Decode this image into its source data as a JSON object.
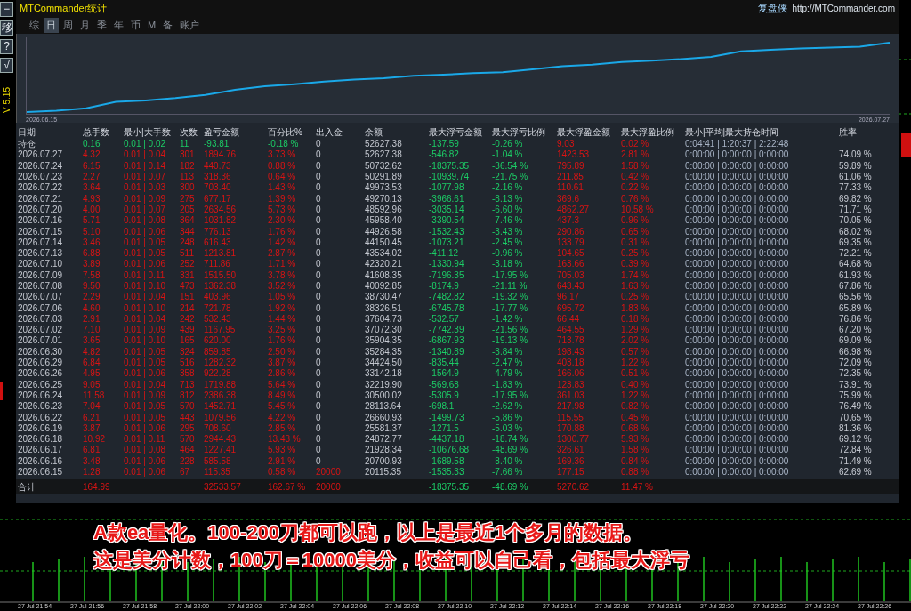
{
  "window": {
    "title": "MTCommander统计",
    "brand": "复盘侠",
    "url": "http://MTCommander.com"
  },
  "side_toolbar": {
    "buttons": [
      "−",
      "移",
      "?",
      "√"
    ],
    "version": "V 5.15"
  },
  "tabs": [
    {
      "label": "综",
      "selected": false
    },
    {
      "label": "日",
      "selected": true
    },
    {
      "label": "周",
      "selected": false
    },
    {
      "label": "月",
      "selected": false
    },
    {
      "label": "季",
      "selected": false
    },
    {
      "label": "年",
      "selected": false
    },
    {
      "label": "币",
      "selected": false
    },
    {
      "label": "M",
      "selected": false
    },
    {
      "label": "备",
      "selected": false
    },
    {
      "label": "账户",
      "selected": false
    }
  ],
  "equity_chart": {
    "start_label": "2026.06.15",
    "end_label": "2026.07.27"
  },
  "table": {
    "columns": [
      "日期",
      "总手数",
      "最小|大手数",
      "次数",
      "盈亏金额",
      "百分比%",
      "出入金",
      "余额",
      "最大浮亏金额",
      "最大浮亏比例",
      "最大浮盈金额",
      "最大浮盈比例",
      "最小|平均|最大持仓时间",
      "胜率"
    ],
    "rows": [
      {
        "kind": "open",
        "cells": [
          "持仓",
          "0.16",
          "0.01 | 0.02",
          "11",
          "-93.81",
          "-0.18 %",
          "0",
          "52627.38",
          "-137.59",
          "-0.26 %",
          "9.03",
          "0.02 %",
          "0:04:41 | 1:20:37 | 2:22:48",
          null
        ]
      },
      {
        "kind": "day",
        "cells": [
          "2026.07.27",
          "4.32",
          "0.01 | 0.04",
          "301",
          "1894.76",
          "3.73 %",
          "0",
          "52627.38",
          "-546.82",
          "-1.04 %",
          "1423.53",
          "2.81 %",
          "0:00:00 | 0:00:00 | 0:00:00",
          "74.09 %"
        ]
      },
      {
        "kind": "day",
        "cells": [
          "2026.07.24",
          "6.15",
          "0.01 | 0.14",
          "182",
          "440.73",
          "0.88 %",
          "0",
          "50732.62",
          "-18375.35",
          "-36.54 %",
          "795.89",
          "1.58 %",
          "0:00:00 | 0:00:00 | 0:00:00",
          "59.89 %"
        ]
      },
      {
        "kind": "day",
        "cells": [
          "2026.07.23",
          "2.27",
          "0.01 | 0.07",
          "113",
          "318.36",
          "0.64 %",
          "0",
          "50291.89",
          "-10939.74",
          "-21.75 %",
          "211.85",
          "0.42 %",
          "0:00:00 | 0:00:00 | 0:00:00",
          "61.06 %"
        ]
      },
      {
        "kind": "day",
        "cells": [
          "2026.07.22",
          "3.64",
          "0.01 | 0.03",
          "300",
          "703.40",
          "1.43 %",
          "0",
          "49973.53",
          "-1077.98",
          "-2.16 %",
          "110.61",
          "0.22 %",
          "0:00:00 | 0:00:00 | 0:00:00",
          "77.33 %"
        ]
      },
      {
        "kind": "day",
        "cells": [
          "2026.07.21",
          "4.93",
          "0.01 | 0.09",
          "275",
          "677.17",
          "1.39 %",
          "0",
          "49270.13",
          "-3966.61",
          "-8.13 %",
          "369.6",
          "0.76 %",
          "0:00:00 | 0:00:00 | 0:00:00",
          "69.82 %"
        ]
      },
      {
        "kind": "day",
        "cells": [
          "2026.07.20",
          "4.00",
          "0.01 | 0.07",
          "205",
          "2634.56",
          "5.73 %",
          "0",
          "48592.96",
          "-3035.14",
          "-6.60 %",
          "4862.27",
          "10.58 %",
          "0:00:00 | 0:00:00 | 0:00:00",
          "71.71 %"
        ]
      },
      {
        "kind": "day",
        "cells": [
          "2026.07.16",
          "5.71",
          "0.01 | 0.08",
          "364",
          "1031.82",
          "2.30 %",
          "0",
          "45958.40",
          "-3390.54",
          "-7.46 %",
          "437.3",
          "0.96 %",
          "0:00:00 | 0:00:00 | 0:00:00",
          "70.05 %"
        ]
      },
      {
        "kind": "day",
        "cells": [
          "2026.07.15",
          "5.10",
          "0.01 | 0.06",
          "344",
          "776.13",
          "1.76 %",
          "0",
          "44926.58",
          "-1532.43",
          "-3.43 %",
          "290.86",
          "0.65 %",
          "0:00:00 | 0:00:00 | 0:00:00",
          "68.02 %"
        ]
      },
      {
        "kind": "day",
        "cells": [
          "2026.07.14",
          "3.46",
          "0.01 | 0.05",
          "248",
          "616.43",
          "1.42 %",
          "0",
          "44150.45",
          "-1073.21",
          "-2.45 %",
          "133.79",
          "0.31 %",
          "0:00:00 | 0:00:00 | 0:00:00",
          "69.35 %"
        ]
      },
      {
        "kind": "day",
        "cells": [
          "2026.07.13",
          "6.88",
          "0.01 | 0.05",
          "511",
          "1213.81",
          "2.87 %",
          "0",
          "43534.02",
          "-411.12",
          "-0.96 %",
          "104.65",
          "0.25 %",
          "0:00:00 | 0:00:00 | 0:00:00",
          "72.21 %"
        ]
      },
      {
        "kind": "day",
        "cells": [
          "2026.07.10",
          "3.89",
          "0.01 | 0.06",
          "252",
          "711.86",
          "1.71 %",
          "0",
          "42320.21",
          "-1330.94",
          "-3.18 %",
          "163.66",
          "0.39 %",
          "0:00:00 | 0:00:00 | 0:00:00",
          "64.68 %"
        ]
      },
      {
        "kind": "day",
        "cells": [
          "2026.07.09",
          "7.58",
          "0.01 | 0.11",
          "331",
          "1515.50",
          "3.78 %",
          "0",
          "41608.35",
          "-7196.35",
          "-17.95 %",
          "705.03",
          "1.74 %",
          "0:00:00 | 0:00:00 | 0:00:00",
          "61.93 %"
        ]
      },
      {
        "kind": "day",
        "cells": [
          "2026.07.08",
          "9.50",
          "0.01 | 0.10",
          "473",
          "1362.38",
          "3.52 %",
          "0",
          "40092.85",
          "-8174.9",
          "-21.11 %",
          "643.43",
          "1.63 %",
          "0:00:00 | 0:00:00 | 0:00:00",
          "67.86 %"
        ]
      },
      {
        "kind": "day",
        "cells": [
          "2026.07.07",
          "2.29",
          "0.01 | 0.04",
          "151",
          "403.96",
          "1.05 %",
          "0",
          "38730.47",
          "-7482.82",
          "-19.32 %",
          "96.17",
          "0.25 %",
          "0:00:00 | 0:00:00 | 0:00:00",
          "65.56 %"
        ]
      },
      {
        "kind": "day",
        "cells": [
          "2026.07.06",
          "4.60",
          "0.01 | 0.10",
          "214",
          "721.78",
          "1.92 %",
          "0",
          "38326.51",
          "-6745.78",
          "-17.77 %",
          "695.72",
          "1.83 %",
          "0:00:00 | 0:00:00 | 0:00:00",
          "65.89 %"
        ]
      },
      {
        "kind": "day",
        "cells": [
          "2026.07.03",
          "2.91",
          "0.01 | 0.04",
          "242",
          "532.43",
          "1.44 %",
          "0",
          "37604.73",
          "-532.57",
          "-1.42 %",
          "66.44",
          "0.18 %",
          "0:00:00 | 0:00:00 | 0:00:00",
          "76.86 %"
        ]
      },
      {
        "kind": "day",
        "cells": [
          "2026.07.02",
          "7.10",
          "0.01 | 0.09",
          "439",
          "1167.95",
          "3.25 %",
          "0",
          "37072.30",
          "-7742.39",
          "-21.56 %",
          "464.55",
          "1.29 %",
          "0:00:00 | 0:00:00 | 0:00:00",
          "67.20 %"
        ]
      },
      {
        "kind": "day",
        "cells": [
          "2026.07.01",
          "3.65",
          "0.01 | 0.10",
          "165",
          "620.00",
          "1.76 %",
          "0",
          "35904.35",
          "-6867.93",
          "-19.13 %",
          "713.78",
          "2.02 %",
          "0:00:00 | 0:00:00 | 0:00:00",
          "69.09 %"
        ]
      },
      {
        "kind": "day",
        "cells": [
          "2026.06.30",
          "4.82",
          "0.01 | 0.05",
          "324",
          "859.85",
          "2.50 %",
          "0",
          "35284.35",
          "-1340.89",
          "-3.84 %",
          "198.43",
          "0.57 %",
          "0:00:00 | 0:00:00 | 0:00:00",
          "66.98 %"
        ]
      },
      {
        "kind": "day",
        "cells": [
          "2026.06.29",
          "6.84",
          "0.01 | 0.05",
          "516",
          "1282.32",
          "3.87 %",
          "0",
          "34424.50",
          "-835.44",
          "-2.47 %",
          "403.18",
          "1.22 %",
          "0:00:00 | 0:00:00 | 0:00:00",
          "72.09 %"
        ]
      },
      {
        "kind": "day",
        "cells": [
          "2026.06.26",
          "4.95",
          "0.01 | 0.06",
          "358",
          "922.28",
          "2.86 %",
          "0",
          "33142.18",
          "-1564.9",
          "-4.79 %",
          "166.06",
          "0.51 %",
          "0:00:00 | 0:00:00 | 0:00:00",
          "72.35 %"
        ]
      },
      {
        "kind": "day",
        "cells": [
          "2026.06.25",
          "9.05",
          "0.01 | 0.04",
          "713",
          "1719.88",
          "5.64 %",
          "0",
          "32219.90",
          "-569.68",
          "-1.83 %",
          "123.83",
          "0.40 %",
          "0:00:00 | 0:00:00 | 0:00:00",
          "73.91 %"
        ]
      },
      {
        "kind": "day",
        "cells": [
          "2026.06.24",
          "11.58",
          "0.01 | 0.09",
          "812",
          "2386.38",
          "8.49 %",
          "0",
          "30500.02",
          "-5305.9",
          "-17.95 %",
          "361.03",
          "1.22 %",
          "0:00:00 | 0:00:00 | 0:00:00",
          "75.99 %"
        ]
      },
      {
        "kind": "day",
        "cells": [
          "2026.06.23",
          "7.04",
          "0.01 | 0.05",
          "570",
          "1452.71",
          "5.45 %",
          "0",
          "28113.64",
          "-698.1",
          "-2.62 %",
          "217.98",
          "0.82 %",
          "0:00:00 | 0:00:00 | 0:00:00",
          "76.49 %"
        ]
      },
      {
        "kind": "day",
        "cells": [
          "2026.06.22",
          "6.21",
          "0.01 | 0.05",
          "443",
          "1079.56",
          "4.22 %",
          "0",
          "26660.93",
          "-1499.73",
          "-5.86 %",
          "115.55",
          "0.45 %",
          "0:00:00 | 0:00:00 | 0:00:00",
          "70.65 %"
        ]
      },
      {
        "kind": "day",
        "cells": [
          "2026.06.19",
          "3.87",
          "0.01 | 0.06",
          "295",
          "708.60",
          "2.85 %",
          "0",
          "25581.37",
          "-1271.5",
          "-5.03 %",
          "170.88",
          "0.68 %",
          "0:00:00 | 0:00:00 | 0:00:00",
          "81.36 %"
        ]
      },
      {
        "kind": "day",
        "cells": [
          "2026.06.18",
          "10.92",
          "0.01 | 0.11",
          "570",
          "2944.43",
          "13.43 %",
          "0",
          "24872.77",
          "-4437.18",
          "-18.74 %",
          "1300.77",
          "5.93 %",
          "0:00:00 | 0:00:00 | 0:00:00",
          "69.12 %"
        ]
      },
      {
        "kind": "day",
        "cells": [
          "2026.06.17",
          "6.81",
          "0.01 | 0.08",
          "464",
          "1227.41",
          "5.93 %",
          "0",
          "21928.34",
          "-10676.68",
          "-48.69 %",
          "326.61",
          "1.58 %",
          "0:00:00 | 0:00:00 | 0:00:00",
          "72.84 %"
        ]
      },
      {
        "kind": "day",
        "cells": [
          "2026.06.16",
          "3.48",
          "0.01 | 0.06",
          "228",
          "585.58",
          "2.91 %",
          "0",
          "20700.93",
          "-1689.58",
          "-8.40 %",
          "169.36",
          "0.84 %",
          "0:00:00 | 0:00:00 | 0:00:00",
          "71.49 %"
        ]
      },
      {
        "kind": "day",
        "cells": [
          "2026.06.15",
          "1.28",
          "0.01 | 0.06",
          "67",
          "115.35",
          "0.58 %",
          "20000",
          "20115.35",
          "-1535.33",
          "-7.66 %",
          "177.15",
          "0.88 %",
          "0:00:00 | 0:00:00 | 0:00:00",
          "62.69 %"
        ]
      },
      {
        "kind": "total",
        "cells": [
          "合计",
          "164.99",
          null,
          null,
          "32533.57",
          "162.67 %",
          "20000",
          null,
          "-18375.35",
          "-48.69 %",
          "5270.62",
          "11.47 %",
          null,
          null
        ]
      }
    ]
  },
  "caption": [
    "A款ea量化。100-200刀都可以跑，以上是最近1个多月的数据。",
    "这是美分计数，100刀＝10000美分，收益可以自己看，包括最大浮亏"
  ],
  "time_axis": [
    "27 Jul 21:54",
    "27 Jul 21:56",
    "27 Jul 21:58",
    "27 Jul 22:00",
    "27 Jul 22:02",
    "27 Jul 22:04",
    "27 Jul 22:06",
    "27 Jul 22:08",
    "27 Jul 22:10",
    "27 Jul 22:12",
    "27 Jul 22:14",
    "27 Jul 22:16",
    "27 Jul 22:18",
    "27 Jul 22:20",
    "27 Jul 22:22",
    "27 Jul 22:24",
    "27 Jul 22:26"
  ]
}
